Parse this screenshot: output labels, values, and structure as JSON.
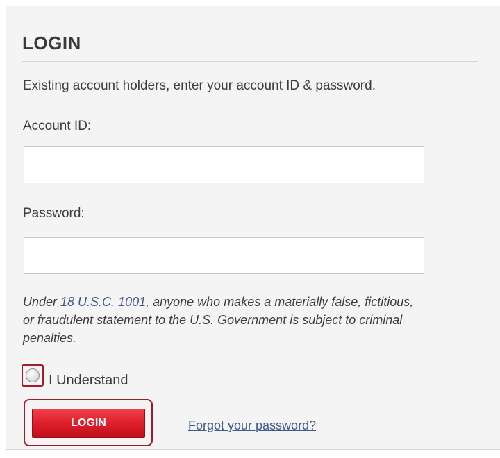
{
  "login": {
    "title": "LOGIN",
    "intro": "Existing account holders, enter your account ID & password.",
    "account_label": "Account ID:",
    "account_value": "",
    "password_label": "Password:",
    "password_value": "",
    "legal_prefix": "Under ",
    "legal_link": "18 U.S.C. 1001",
    "legal_suffix": ", anyone who makes a materially false, fictitious, or fraudulent statement to the U.S. Government is subject to criminal penalties.",
    "acknowledge_label": "I Understand",
    "acknowledge_checked": false,
    "submit_label": "LOGIN",
    "forgot_link": "Forgot your password?"
  },
  "colors": {
    "panel_background": "#f4f4f4",
    "button_red": "#de1f2b",
    "highlight_outline": "#a01c2a",
    "link_blue": "#3d5a8a"
  },
  "icons": {
    "acknowledge_control": "radio-button-icon"
  }
}
